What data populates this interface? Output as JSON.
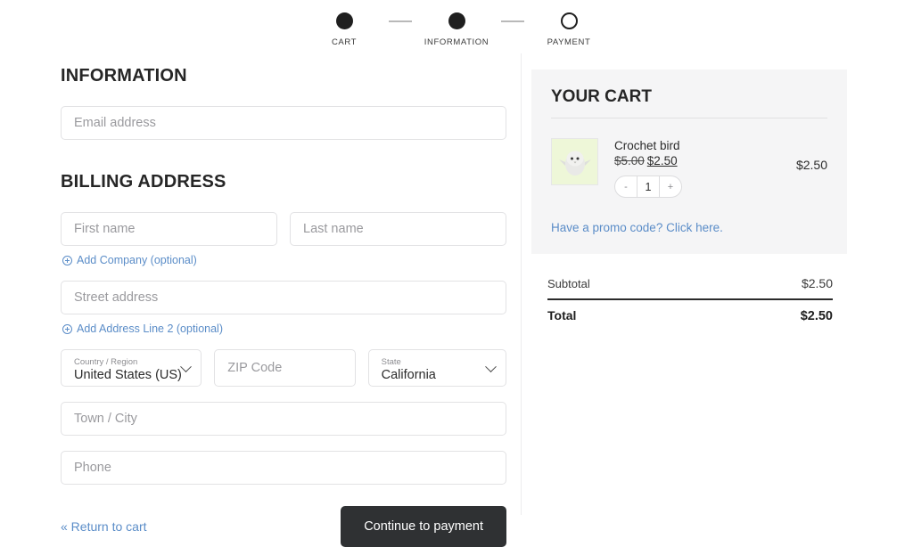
{
  "stepper": {
    "steps": [
      {
        "label": "CART",
        "state": "filled"
      },
      {
        "label": "INFORMATION",
        "state": "filled"
      },
      {
        "label": "PAYMENT",
        "state": "hollow"
      }
    ]
  },
  "form": {
    "information_title": "INFORMATION",
    "email_placeholder": "Email address",
    "billing_title": "BILLING ADDRESS",
    "first_name_placeholder": "First name",
    "last_name_placeholder": "Last name",
    "add_company_label": "Add Company (optional)",
    "street_placeholder": "Street address",
    "add_address_line2_label": "Add Address Line 2 (optional)",
    "country_label": "Country / Region",
    "country_value": "United States (US)",
    "zip_placeholder": "ZIP Code",
    "state_label": "State",
    "state_value": "California",
    "city_placeholder": "Town / City",
    "phone_placeholder": "Phone",
    "return_link": "« Return to cart",
    "continue_button": "Continue to payment"
  },
  "cart": {
    "title": "YOUR CART",
    "item": {
      "name": "Crochet bird",
      "price_old": "$5.00",
      "price_new": "$2.50",
      "qty_minus": "-",
      "qty_value": "1",
      "qty_plus": "+",
      "line_total": "$2.50"
    },
    "promo_label": "Have a promo code? Click here.",
    "subtotal_label": "Subtotal",
    "subtotal_value": "$2.50",
    "total_label": "Total",
    "total_value": "$2.50"
  },
  "colors": {
    "link_blue": "#5b8dc8",
    "button_dark": "#2f3133",
    "panel_grey": "#f5f5f6",
    "thumb_bg": "#eef7d8"
  }
}
